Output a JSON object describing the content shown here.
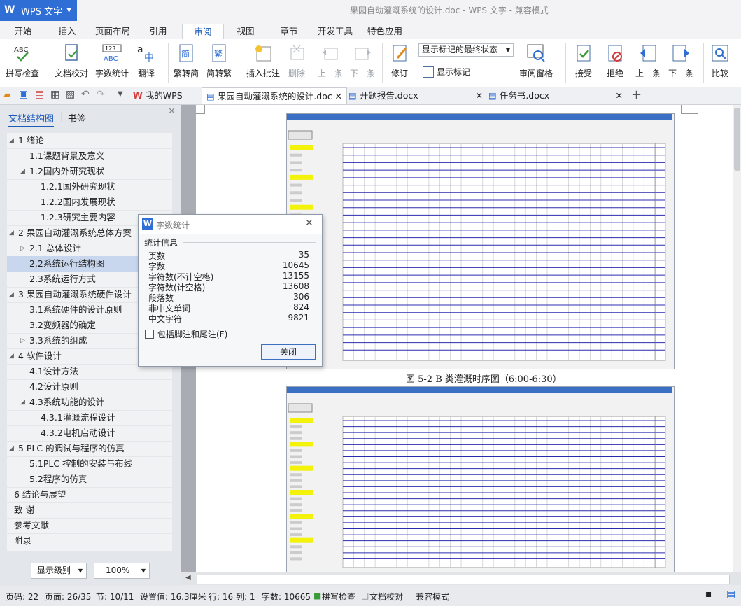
{
  "app": {
    "name": "WPS 文字",
    "title": "果园自动灌溉系统的设计.doc - WPS 文字 - 兼容模式"
  },
  "ribbon_tabs": [
    "开始",
    "插入",
    "页面布局",
    "引用",
    "审阅",
    "视图",
    "章节",
    "开发工具",
    "特色应用"
  ],
  "active_tab": "审阅",
  "ribbon": {
    "spellcheck": "拼写检查",
    "doccheck": "文档校对",
    "wordcount": "字数统计",
    "translate": "翻译",
    "trad_to_simp": "繁转简",
    "simp_to_trad": "简转繁",
    "insert_comment": "插入批注",
    "delete": "删除",
    "prev": "上一条",
    "next": "下一条",
    "track": "修订",
    "show_markup_dropdown": "显示标记的最终状态",
    "show_markup": "显示标记",
    "review_pane": "审阅窗格",
    "accept": "接受",
    "reject": "拒绝",
    "prev2": "上一条",
    "next2": "下一条",
    "compare": "比较"
  },
  "doc_tabs": {
    "mywps": "我的WPS",
    "tab1": "果园自动灌溉系统的设计.doc",
    "tab2": "开题报告.docx",
    "tab3": "任务书.docx"
  },
  "left_panel": {
    "tab_outline": "文档结构图",
    "tab_bookmarks": "书签",
    "items": [
      "1   绪论",
      "1.1课题背景及意义",
      "1.2国内外研究现状",
      "1.2.1国外研究现状",
      "1.2.2国内发展现状",
      "1.2.3研究主要内容",
      "2   果园自动灌溉系统总体方案",
      "2.1  总体设计",
      "2.2系统运行结构图",
      "2.3系统运行方式",
      "3   果园自动灌溉系统硬件设计",
      "3.1系统硬件的设计原则",
      "3.2变频器的确定",
      "3.3系统的组成",
      "4   软件设计",
      "4.1设计方法",
      "4.2设计原则",
      "4.3系统功能的设计",
      "4.3.1灌溉流程设计",
      "4.3.2电机启动设计",
      "5   PLC 的调试与程序的仿真",
      "5.1PLC 控制的安装与布线",
      "5.2程序的仿真",
      "6   结论与展望",
      "致   谢",
      "参考文献",
      "附录"
    ],
    "level_select": "显示级别",
    "zoom_select": "100%"
  },
  "dialog": {
    "title": "字数统计",
    "section": "统计信息",
    "rows": [
      {
        "label": "页数",
        "value": "35"
      },
      {
        "label": "字数",
        "value": "10645"
      },
      {
        "label": "字符数(不计空格)",
        "value": "13155"
      },
      {
        "label": "字符数(计空格)",
        "value": "13608"
      },
      {
        "label": "段落数",
        "value": "306"
      },
      {
        "label": "非中文单词",
        "value": "824"
      },
      {
        "label": "中文字符",
        "value": "9821"
      }
    ],
    "checkbox": "包括脚注和尾注(F)",
    "close": "关闭"
  },
  "document": {
    "caption1": "图 5-2 B 类灌溉时序图（6:00-6:30）"
  },
  "status": {
    "page": "页码: 22",
    "pages": "页面: 26/35",
    "section": "节: 10/11",
    "setting": "设置值: 16.3厘米",
    "row": "行: 16",
    "col": "列: 1",
    "words": "字数: 10665",
    "spell": "拼写检查",
    "proof": "文档校对",
    "compat": "兼容模式"
  },
  "colors": {
    "accent": "#2e6ed5",
    "selection": "#c8d7ee",
    "link_blue": "#1d5bb8"
  }
}
